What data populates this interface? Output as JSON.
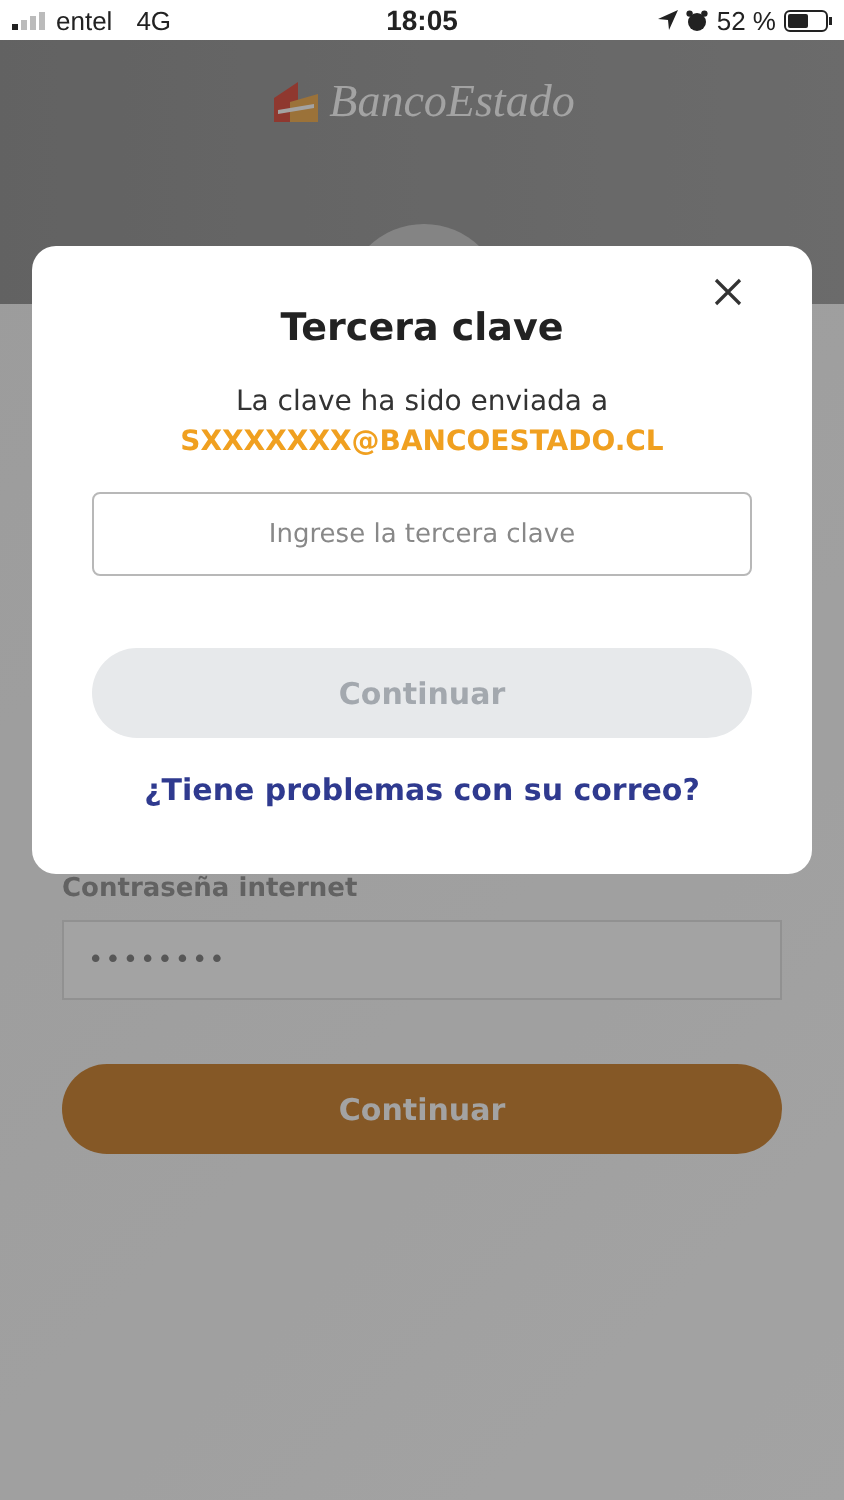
{
  "status_bar": {
    "carrier": "entel",
    "network": "4G",
    "time": "18:05",
    "battery": "52 %"
  },
  "background": {
    "logo": "BancoEstado",
    "password_label": "Contraseña internet",
    "password_value": "••••••••",
    "button": "Continuar"
  },
  "modal": {
    "title": "Tercera clave",
    "message": "La clave ha sido enviada a",
    "email": "SXXXXXXX@BANCOESTADO.CL",
    "input": {
      "placeholder": "Ingrese la tercera clave"
    },
    "button": {
      "label": "Continuar",
      "disabled": true
    },
    "link": "¿Tiene problemas con su correo?"
  }
}
